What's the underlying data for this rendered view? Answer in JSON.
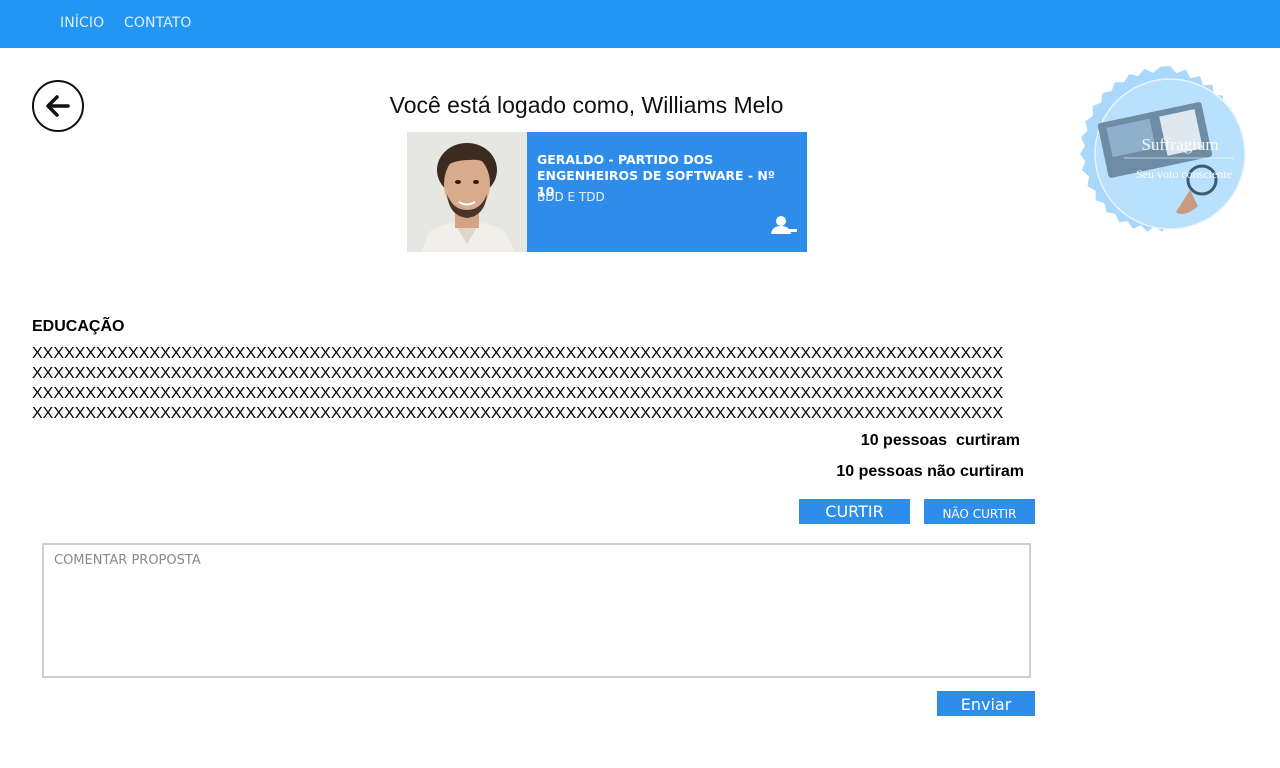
{
  "nav": {
    "items": [
      {
        "label": "INÍCIO"
      },
      {
        "label": "CONTATO"
      }
    ]
  },
  "header": {
    "greeting": "Você está logado como, Williams Melo"
  },
  "candidate": {
    "name": "GERALDO - PARTIDO DOS ENGENHEIROS DE SOFTWARE - Nº 10",
    "proposal": "BDD E TDD",
    "icon": "remove-user-icon"
  },
  "logo": {
    "title": "Suffragium",
    "tagline": "Seu voto consciente"
  },
  "proposal": {
    "title": "EDUCAÇÃO",
    "text": "XXXXXXXXXXXXXXXXXXXXXXXXXXXXXXXXXXXXXXXXXXXXXXXXXXXXXXXXXXXXXXXXXXXXXXXXXXXXXXXXXXXXXXXXXXXXXXXXXXXXXXXXXXXXXXXXXXXXXXXXXXXXXXXXXXXXXXXXXXXXXXXXXXXXXXXXXXXXXXXXXXXXXXXXXXXXXXXXXXXXXXXXXXXXXXXXXXXXXXXXXXXXXXXXXXXXXXXXXXXXXXXXXXXXXXXXXXXXXXXXXXXXXXXXXXXXXXXXXXXXXXXXXXXXXXXXXXXXXXXXXXXXXXXXXXXXXXXXXXXXXXXXXXXXXXXXXXXXXXXXXXXXXXXXXXXXXXXXXXXXXXXXXXXXXXXXXXXXXXXXXXXXXXXXXXXXXXXXXXXXXXXXXXXX",
    "likes_text": "10 pessoas  curtiram",
    "dislikes_text": "10 pessoas não curtiram"
  },
  "actions": {
    "like_label": "CURTIR",
    "dislike_label": "NÃO CURTIR"
  },
  "comment": {
    "placeholder": "COMENTAR PROPOSTA",
    "value": "",
    "send_label": "Enviar"
  },
  "colors": {
    "primary": "#2196f3",
    "accent": "#2e8ceb",
    "seal": "#a9d8fb"
  }
}
